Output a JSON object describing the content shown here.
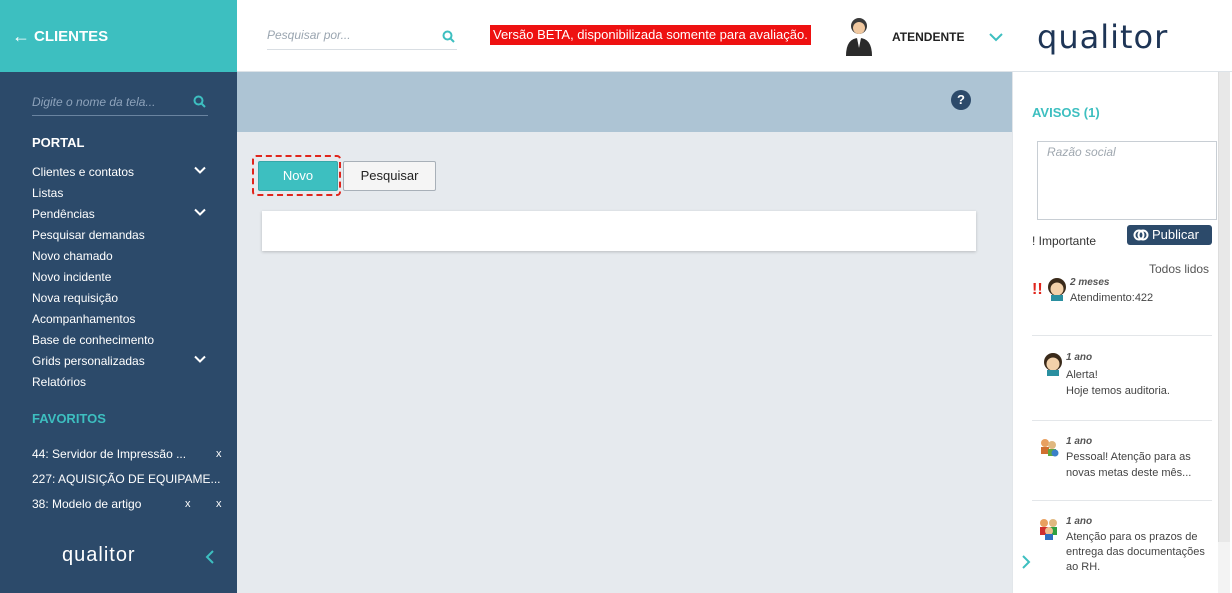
{
  "sidebar": {
    "back_label": "CLIENTES",
    "search_placeholder": "Digite o nome da tela...",
    "portal_title": "PORTAL",
    "items": [
      {
        "label": "Clientes e contatos",
        "expandable": true
      },
      {
        "label": "Listas",
        "expandable": false
      },
      {
        "label": "Pendências",
        "expandable": true
      },
      {
        "label": "Pesquisar demandas",
        "expandable": false
      },
      {
        "label": "Novo chamado",
        "expandable": false
      },
      {
        "label": "Novo incidente",
        "expandable": false
      },
      {
        "label": "Nova requisição",
        "expandable": false
      },
      {
        "label": "Acompanhamentos",
        "expandable": false
      },
      {
        "label": "Base de conhecimento",
        "expandable": false
      },
      {
        "label": "Grids personalizadas",
        "expandable": true
      },
      {
        "label": "Relatórios",
        "expandable": false
      }
    ],
    "favorites_title": "FAVORITOS",
    "favorites": [
      {
        "label": "44: Servidor de Impressão ...",
        "close": [
          "x"
        ]
      },
      {
        "label": "227: AQUISIÇÃO DE EQUIPAME...",
        "close": []
      },
      {
        "label": "38: Modelo de artigo",
        "close": [
          "x",
          "x"
        ]
      }
    ],
    "logo_text": "qualitor",
    "collapse_icon": "chevron-left-icon"
  },
  "topbar": {
    "search_placeholder": "Pesquisar por...",
    "beta_notice": "Versão BETA, disponibilizada somente para avaliação.",
    "user_role": "ATENDENTE",
    "brand": "qualitor"
  },
  "main": {
    "help_icon": "?",
    "buttons": {
      "novo": "Novo",
      "pesquisar": "Pesquisar"
    }
  },
  "avisos": {
    "title": "AVISOS (1)",
    "razao_placeholder": "Razão social",
    "importante_label": "! Importante",
    "publicar_label": "Publicar",
    "todos_lidos": "Todos lidos",
    "notifications": [
      {
        "important": "!!",
        "time": "2 meses",
        "lines": [
          "Atendimento:422"
        ]
      },
      {
        "important": "",
        "time": "1 ano",
        "lines": [
          "Alerta!",
          "Hoje temos auditoria."
        ]
      },
      {
        "important": "",
        "time": "1 ano",
        "lines": [
          "Pessoal! Atenção para as",
          "novas metas deste mês..."
        ]
      },
      {
        "important": "",
        "time": "1 ano",
        "lines": [
          "Atenção para os prazos de",
          "entrega das documentações",
          "ao RH."
        ]
      }
    ]
  },
  "colors": {
    "teal": "#3dbfc0",
    "navy": "#2c4a6a",
    "beta_red": "#ee1111"
  }
}
